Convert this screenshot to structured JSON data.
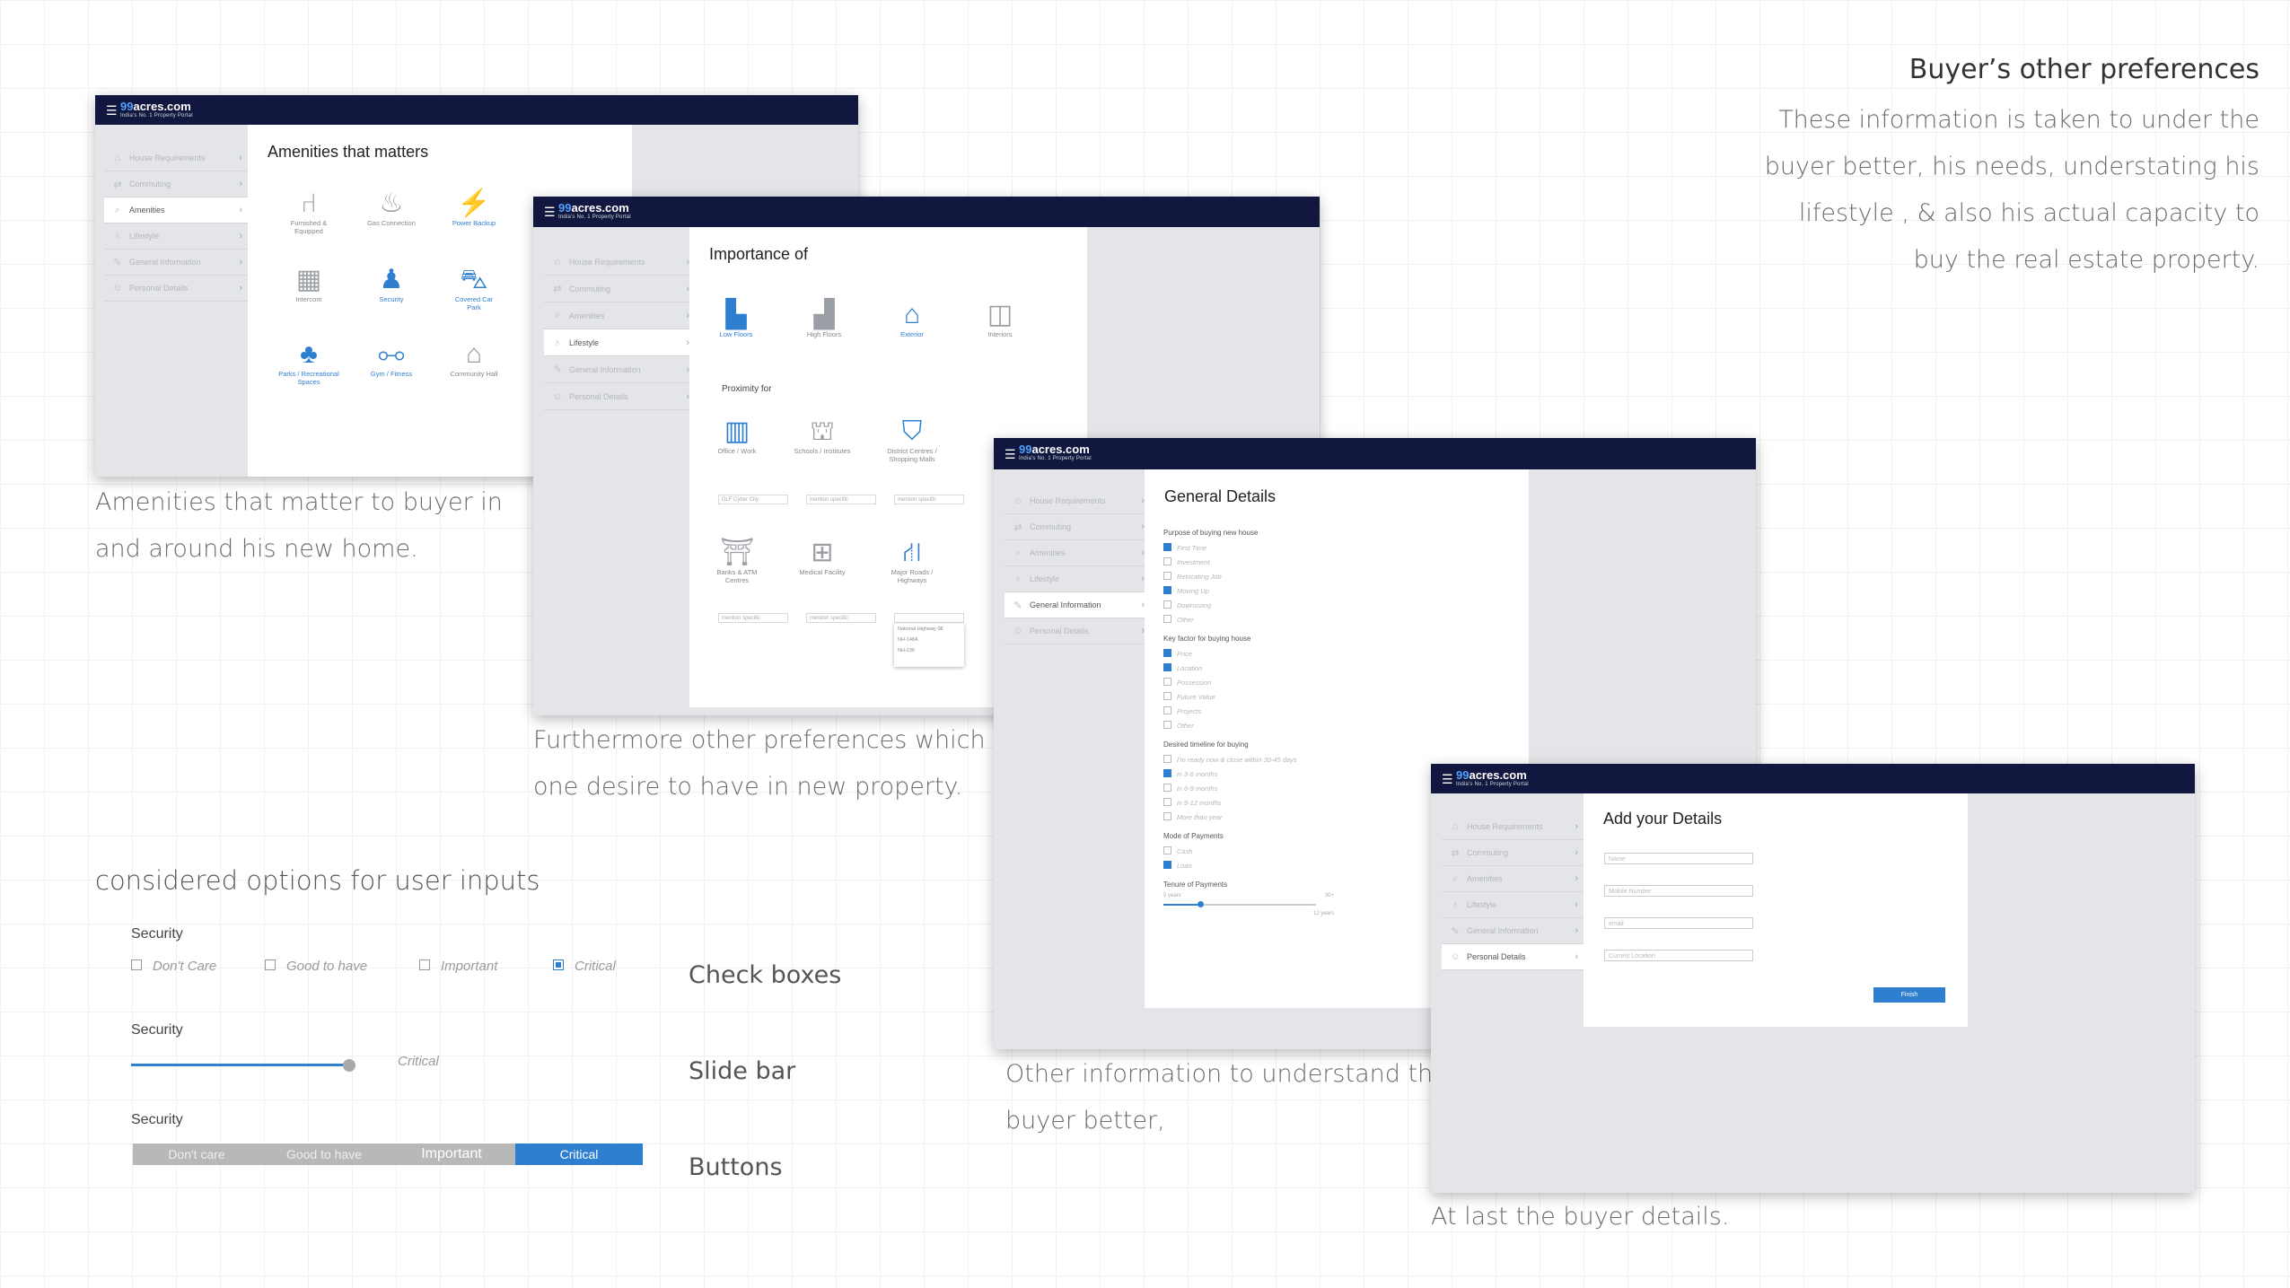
{
  "header": {
    "title": "Buyer’s other preferences",
    "description": [
      "These information is taken to under the",
      "buyer better, his needs, understating his",
      "lifestyle , & also his actual capacity to",
      "buy the real estate property."
    ]
  },
  "captions": {
    "amenities": [
      "Amenities that matter to buyer in",
      "and around his new home."
    ],
    "preferences": [
      "Furthermore other preferences which",
      "one desire to have in new property."
    ],
    "general": [
      "Other information to understand the",
      "buyer better,"
    ],
    "details": "At last the buyer details.",
    "options_heading": "considered options for user inputs"
  },
  "brand": {
    "logo_num": "99",
    "logo_rest": "acres.com",
    "tagline": "India’s No. 1 Property Portal"
  },
  "sidebar": [
    "House Requirements",
    "Commuting",
    "Amenities",
    "Lifestyle",
    "General Information",
    "Personal Details"
  ],
  "screen1": {
    "title": "Amenities that matters",
    "tiles": [
      "Furnished & Equipped",
      "Gas Connection",
      "Power Backup",
      "Intercom",
      "Security",
      "Covered Car Park",
      "Parks / Recreational Spaces",
      "Gym / Fitness",
      "Community Hall"
    ]
  },
  "screen2": {
    "title": "Importance of",
    "importance": [
      "Low Floors",
      "High Floors",
      "Exterior",
      "Interiors"
    ],
    "proximity_heading": "Proximity for",
    "proximity": [
      "Office / Work",
      "Schools / Institutes",
      "District Centres / Shopping Malls",
      "Banks & ATM Centres",
      "Medical Facility",
      "Major Roads / Highways"
    ],
    "dropdowns": [
      "DLF Cyber City",
      "mention specific",
      "mention specific",
      "mention specific",
      "mention specific",
      ""
    ],
    "popup": [
      "National Highway 08",
      "NH-148A",
      "NH-236"
    ]
  },
  "screen3": {
    "title": "General Details",
    "groups": [
      {
        "heading": "Purpose of buying new house",
        "options": [
          "First Time",
          "Investment",
          "Relocating Job",
          "Moving Up",
          "Downsizing",
          "Other"
        ]
      },
      {
        "heading": "Key factor for buying house",
        "options": [
          "Price",
          "Location",
          "Possession",
          "Future Value",
          "Projects",
          "Other"
        ]
      },
      {
        "heading": "Desired timeline for buying",
        "options": [
          "I'm ready now & close within 30-45 days",
          "in 3-6 months",
          "in 6-9 months",
          "in 9-12 months",
          "More than year"
        ]
      },
      {
        "heading": "Mode of Payments",
        "options": [
          "Cash",
          "Loan"
        ]
      }
    ],
    "tenure_heading": "Tenure of Payments",
    "tenure_min": "5 years",
    "tenure_max": "30+",
    "tenure_value": "12 years"
  },
  "screen4": {
    "title": "Add your Details",
    "fields": [
      "Name",
      "Mobile Number",
      "email",
      "Current Location"
    ],
    "finish": "Finish"
  },
  "controls": {
    "security_label": "Security",
    "checkbox_options": [
      "Don't Care",
      "Good to have",
      "Important",
      "Critical"
    ],
    "slider_value_label": "Critical",
    "slider_fraction": 1.0,
    "buttons": [
      "Don't care",
      "Good to have",
      "Important",
      "Critical"
    ],
    "types": [
      "Check boxes",
      "Slide bar",
      "Buttons"
    ]
  }
}
